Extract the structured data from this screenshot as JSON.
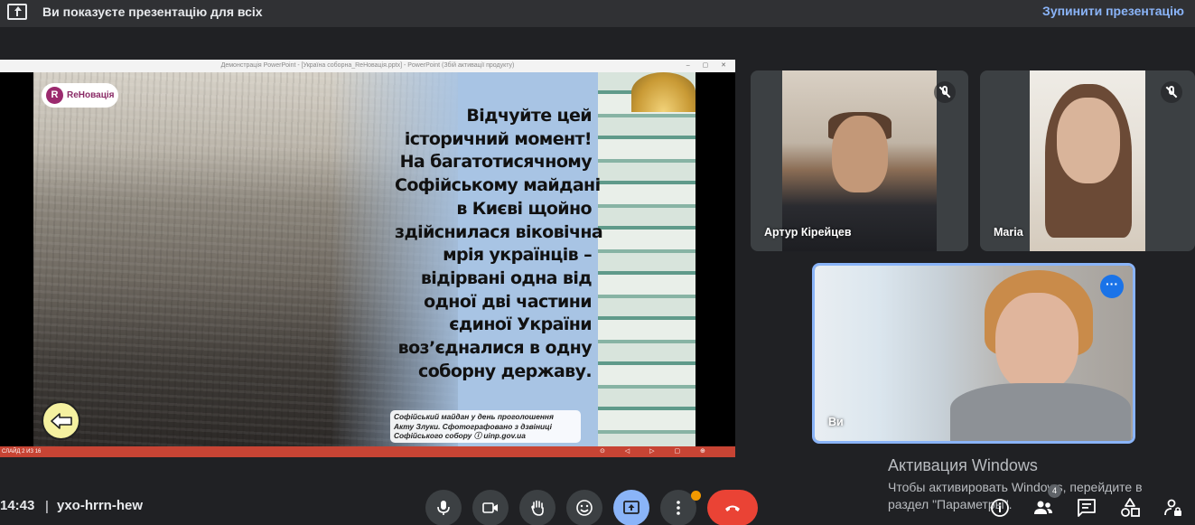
{
  "topbar": {
    "title": "Ви показуєте презентацію для всіх",
    "stop_label": "Зупинити презентацію"
  },
  "slide_window": {
    "title": "Демонстрація PowerPoint - [Україна соборна_ReНовація.pptx] - PowerPoint (Збій активації продукту)",
    "status": "СЛАЙД 2 ИЗ 16",
    "logo_mark": "R",
    "logo_text": "ReНовація",
    "text_lines": [
      "Відчуйте цей",
      "історичний момент!",
      "На багатотисячному",
      "Софійському майдані",
      "в Києві щойно",
      "здійснилася віковічна",
      "мрія українців –",
      "відірвані одна від",
      "одної дві частини",
      "єдиної України",
      "воз’єдналися в одну",
      "соборну державу."
    ],
    "caption_lines": [
      "Софійський майдан у день проголошення",
      "Акту Злуки. Сфотографовано з дзвіниці",
      "Софійського собору ⓘ uinp.gov.ua"
    ]
  },
  "participants": [
    {
      "name": "Артур Кірейцев",
      "muted": true
    },
    {
      "name": "Maria",
      "muted": true
    },
    {
      "name": "Ви",
      "muted": false
    }
  ],
  "watermark": {
    "title": "Активация Windows",
    "line1": "Чтобы активировать Windows, перейдите в",
    "line2": "раздел \"Параметры\"."
  },
  "bottombar": {
    "time": "14:43",
    "separator": "|",
    "meeting_code": "yxo-hrrn-hew",
    "participants_count": "4"
  },
  "colors": {
    "accent": "#8ab4f8",
    "hangup": "#ea4335",
    "bar": "#303134",
    "background": "#202124"
  }
}
